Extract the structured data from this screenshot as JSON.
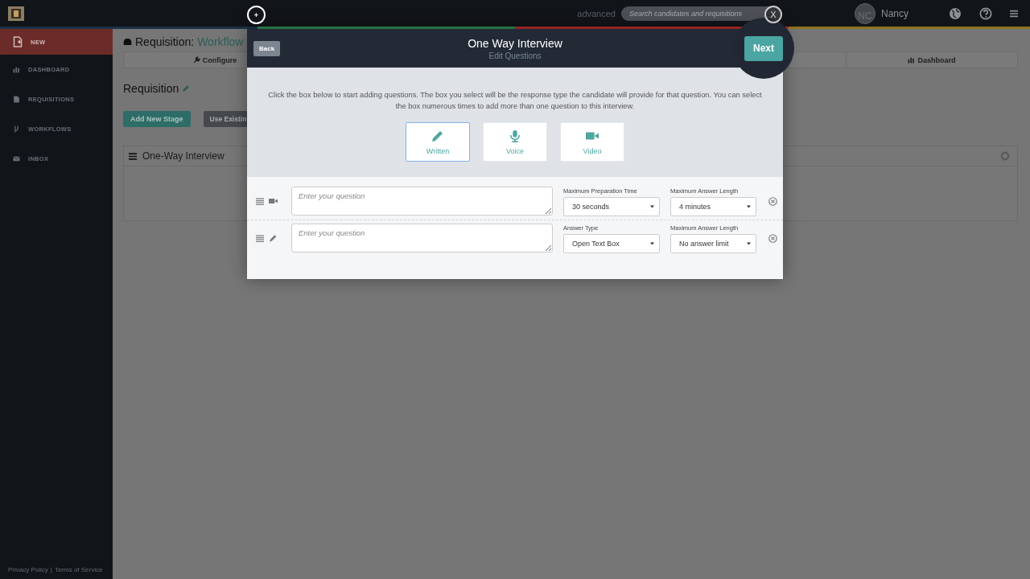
{
  "topbar": {
    "advanced_link": "advanced",
    "search": {
      "placeholder": "Search candidates and requisitions"
    },
    "user": {
      "initials": "NC",
      "name": "Nancy"
    }
  },
  "sidebar": {
    "items": [
      {
        "label": "NEW",
        "selected": true
      },
      {
        "label": "DASHBOARD",
        "selected": false
      },
      {
        "label": "REQUISITIONS",
        "selected": false
      },
      {
        "label": "WORKFLOWS",
        "selected": false
      },
      {
        "label": "INBOX",
        "selected": false
      }
    ],
    "footer_links": [
      "Privacy Policy",
      "Terms of Service"
    ],
    "footer_separator": "|"
  },
  "page": {
    "title_prefix": "Requisition:",
    "title_link": "Workflow",
    "steps": [
      {
        "label": "Configure"
      },
      {
        "label": "Dashboard"
      }
    ],
    "section_title": "Requisition",
    "buttons": [
      {
        "label": "Add New Stage",
        "kind": "primary"
      },
      {
        "label": "Use Existin",
        "kind": "secondary"
      }
    ],
    "panel": {
      "title": "One-Way Interview"
    }
  },
  "tour": {
    "marker": "+",
    "close": "X"
  },
  "modal": {
    "back": "Back",
    "title": "One Way Interview",
    "subtitle": "Edit Questions",
    "next": "Next",
    "instructions": "Click the box below to start adding questions. The box you select will be the response type the candidate will provide for that question. You can select the box numerous times to add more than one question to this interview.",
    "types": [
      {
        "label": "Written",
        "kind": "written",
        "selected": true
      },
      {
        "label": "Voice",
        "kind": "voice",
        "selected": false
      },
      {
        "label": "Video",
        "kind": "video",
        "selected": false
      }
    ],
    "questions": [
      {
        "kind": "video",
        "placeholder": "Enter your question",
        "fields": [
          {
            "label": "Maximum Preparation Time",
            "value": "30 seconds"
          },
          {
            "label": "Maximum Answer Length",
            "value": "4 minutes"
          }
        ]
      },
      {
        "kind": "written",
        "placeholder": "Enter your question",
        "fields": [
          {
            "label": "Answer Type",
            "value": "Open Text Box"
          },
          {
            "label": "Maximum Answer Length",
            "value": "No answer limit"
          }
        ]
      }
    ]
  }
}
